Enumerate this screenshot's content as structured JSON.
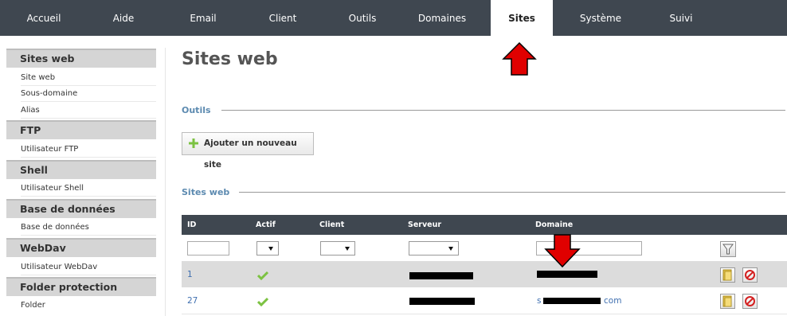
{
  "nav": {
    "tabs": [
      {
        "label": "Accueil"
      },
      {
        "label": "Aide"
      },
      {
        "label": "Email"
      },
      {
        "label": "Client"
      },
      {
        "label": "Outils"
      },
      {
        "label": "Domaines"
      },
      {
        "label": "Sites"
      },
      {
        "label": "Système"
      },
      {
        "label": "Suivi"
      }
    ],
    "active": "Sites"
  },
  "sidebar": {
    "sections": [
      {
        "title": "Sites web",
        "items": [
          "Site web",
          "Sous-domaine",
          "Alias"
        ]
      },
      {
        "title": "FTP",
        "items": [
          "Utilisateur FTP"
        ]
      },
      {
        "title": "Shell",
        "items": [
          "Utilisateur Shell"
        ]
      },
      {
        "title": "Base de données",
        "items": [
          "Base de données"
        ]
      },
      {
        "title": "WebDav",
        "items": [
          "Utilisateur WebDav"
        ]
      },
      {
        "title": "Folder protection",
        "items": [
          "Folder"
        ]
      }
    ]
  },
  "main": {
    "title": "Sites web",
    "tools_label": "Outils",
    "add_button": "Ajouter un nouveau site",
    "list_label": "Sites web"
  },
  "table": {
    "headers": [
      "ID",
      "Actif",
      "Client",
      "Serveur",
      "Domaine"
    ],
    "rows": [
      {
        "id": "1",
        "active": true,
        "server": "",
        "domain": ""
      },
      {
        "id": "27",
        "active": true,
        "server": "",
        "domain_prefix": "s",
        "domain_suffix": "com"
      }
    ]
  },
  "colors": {
    "nav_bg": "#3f4750",
    "link": "#3f6fb0",
    "section_label": "#5c8ab0",
    "check": "#7cc242",
    "arrow": "#e00000"
  }
}
